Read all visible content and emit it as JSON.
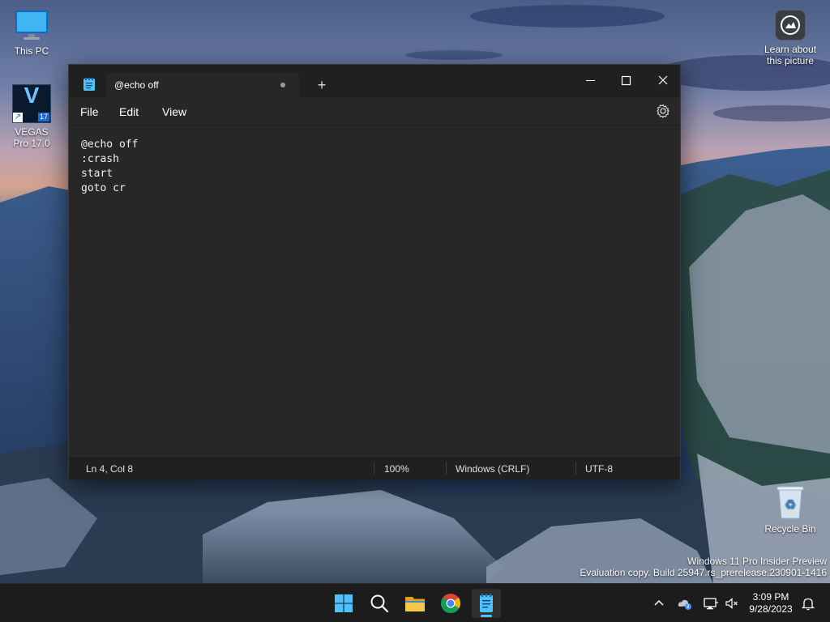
{
  "desktop": {
    "icons": [
      {
        "label": "This PC"
      },
      {
        "label": "VEGAS Pro 17.0"
      },
      {
        "label": "Recycle Bin"
      },
      {
        "label": "Learn about this picture"
      }
    ],
    "vegas_badge": "17",
    "vegas_letter": "V"
  },
  "notepad": {
    "tab_title": "@echo off",
    "new_tab_symbol": "+",
    "menu": [
      "File",
      "Edit",
      "View"
    ],
    "lines": [
      "@echo off",
      ":crash",
      "start",
      "goto cr"
    ],
    "status": {
      "position": "Ln 4, Col 8",
      "zoom": "100%",
      "line_ending": "Windows (CRLF)",
      "encoding": "UTF-8"
    }
  },
  "watermark": {
    "line1": "Windows 11 Pro Insider Preview",
    "line2": "Evaluation copy. Build 25947.rs_prerelease.230901-1416"
  },
  "taskbar": {
    "apps": [
      "start-icon",
      "search-icon",
      "file-explorer-icon",
      "chrome-icon",
      "notepad-icon"
    ],
    "clock": {
      "time": "3:09 PM",
      "date": "9/28/2023"
    }
  },
  "colors": {
    "accent": "#4cc2ff",
    "window_bg": "#272727",
    "titlebar_bg": "#202020",
    "taskbar_bg": "#1c1c1c"
  }
}
